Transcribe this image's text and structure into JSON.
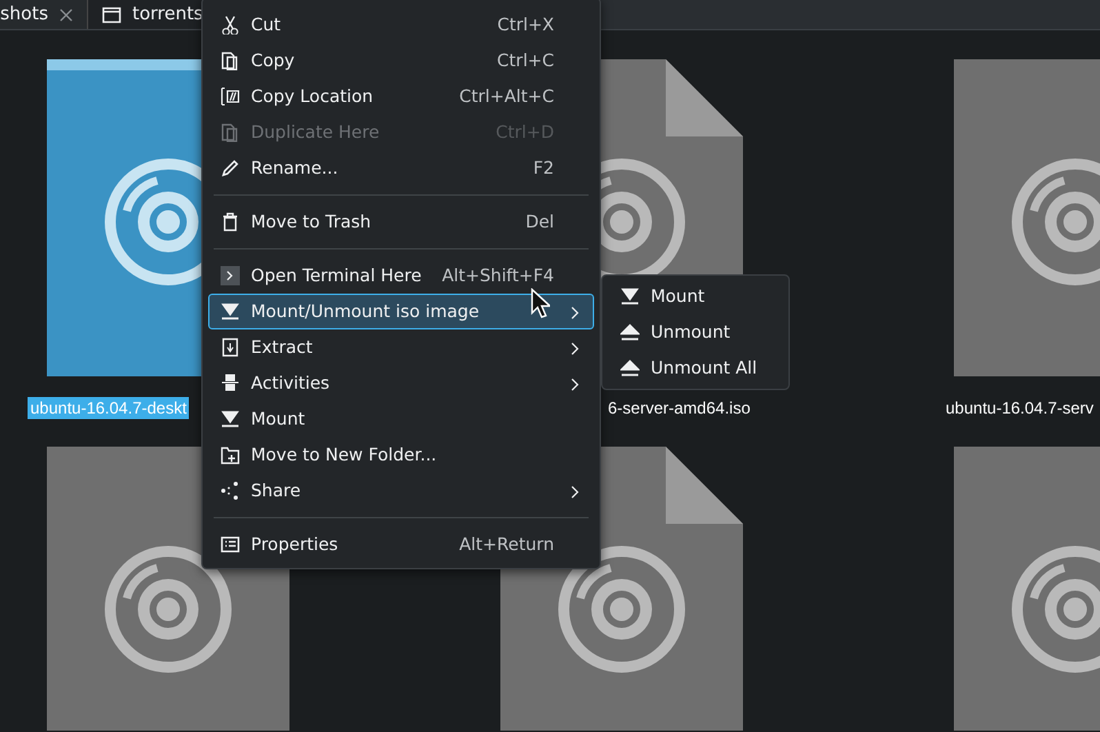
{
  "tabs": [
    {
      "label": "shots",
      "selected": false
    },
    {
      "label": "torrents",
      "selected": true
    }
  ],
  "files": [
    {
      "name": "ubuntu-16.04.7-deskt",
      "selected": true
    },
    {
      "name": "6-server-amd64.iso",
      "selected": false
    },
    {
      "name": "ubuntu-16.04.7-serv",
      "selected": false
    },
    {
      "selected": false
    },
    {
      "selected": false
    },
    {
      "selected": false
    }
  ],
  "context_menu": [
    {
      "kind": "action",
      "label": "Cut",
      "shortcut": "Ctrl+X",
      "disabled": false,
      "selected": false,
      "submenu": false
    },
    {
      "kind": "action",
      "label": "Copy",
      "shortcut": "Ctrl+C",
      "disabled": false,
      "selected": false,
      "submenu": false
    },
    {
      "kind": "action",
      "label": "Copy Location",
      "shortcut": "Ctrl+Alt+C",
      "disabled": false,
      "selected": false,
      "submenu": false
    },
    {
      "kind": "action",
      "label": "Duplicate Here",
      "shortcut": "Ctrl+D",
      "disabled": true,
      "selected": false,
      "submenu": false
    },
    {
      "kind": "action",
      "label": "Rename...",
      "shortcut": "F2",
      "disabled": false,
      "selected": false,
      "submenu": false
    },
    {
      "kind": "separator"
    },
    {
      "kind": "action",
      "label": "Move to Trash",
      "shortcut": "Del",
      "disabled": false,
      "selected": false,
      "submenu": false
    },
    {
      "kind": "separator"
    },
    {
      "kind": "action",
      "label": "Open Terminal Here",
      "shortcut": "Alt+Shift+F4",
      "disabled": false,
      "selected": false,
      "submenu": false
    },
    {
      "kind": "action",
      "label": "Mount/Unmount iso image",
      "disabled": false,
      "selected": true,
      "submenu": true
    },
    {
      "kind": "action",
      "label": "Extract",
      "disabled": false,
      "selected": false,
      "submenu": true
    },
    {
      "kind": "action",
      "label": "Activities",
      "disabled": false,
      "selected": false,
      "submenu": true
    },
    {
      "kind": "action",
      "label": "Mount",
      "disabled": false,
      "selected": false,
      "submenu": false
    },
    {
      "kind": "action",
      "label": "Move to New Folder...",
      "disabled": false,
      "selected": false,
      "submenu": false
    },
    {
      "kind": "action",
      "label": "Share",
      "disabled": false,
      "selected": false,
      "submenu": true
    },
    {
      "kind": "separator"
    },
    {
      "kind": "action",
      "label": "Properties",
      "shortcut": "Alt+Return",
      "disabled": false,
      "selected": false,
      "submenu": false
    }
  ],
  "submenu": [
    {
      "label": "Mount",
      "kind": "mount"
    },
    {
      "label": "Unmount",
      "kind": "eject"
    },
    {
      "label": "Unmount All",
      "kind": "eject"
    }
  ]
}
